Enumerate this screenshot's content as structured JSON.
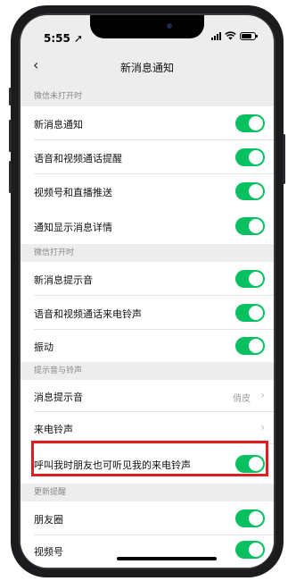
{
  "status": {
    "time": "5:55 ➚"
  },
  "nav": {
    "back": "‹",
    "title": "新消息通知"
  },
  "sections": [
    {
      "header": "微信未打开时",
      "rows": [
        {
          "label": "新消息通知",
          "on": true
        },
        {
          "label": "语音和视频通话提醒",
          "on": true
        },
        {
          "label": "视频号和直播推送",
          "on": true
        },
        {
          "label": "通知显示消息详情",
          "on": true
        }
      ]
    },
    {
      "header": "微信打开时",
      "rows": [
        {
          "label": "新消息提示音",
          "on": true
        },
        {
          "label": "语音和视频通话来电铃声",
          "on": true
        },
        {
          "label": "振动",
          "on": true
        }
      ]
    },
    {
      "header": "提示音与铃声",
      "rows": [
        {
          "label": "消息提示音",
          "value": "俏皮",
          "chevron": "›"
        },
        {
          "label": "来电铃声",
          "chevron": "›"
        },
        {
          "label": "呼叫我时朋友也可听见我的来电铃声",
          "on": true
        }
      ]
    },
    {
      "header": "更新提醒",
      "rows": [
        {
          "label": "朋友圈",
          "on": true
        },
        {
          "label": "视频号",
          "on": true
        }
      ]
    }
  ],
  "colors": {
    "toggle_on": "#07c160",
    "highlight": "#e11d24"
  }
}
